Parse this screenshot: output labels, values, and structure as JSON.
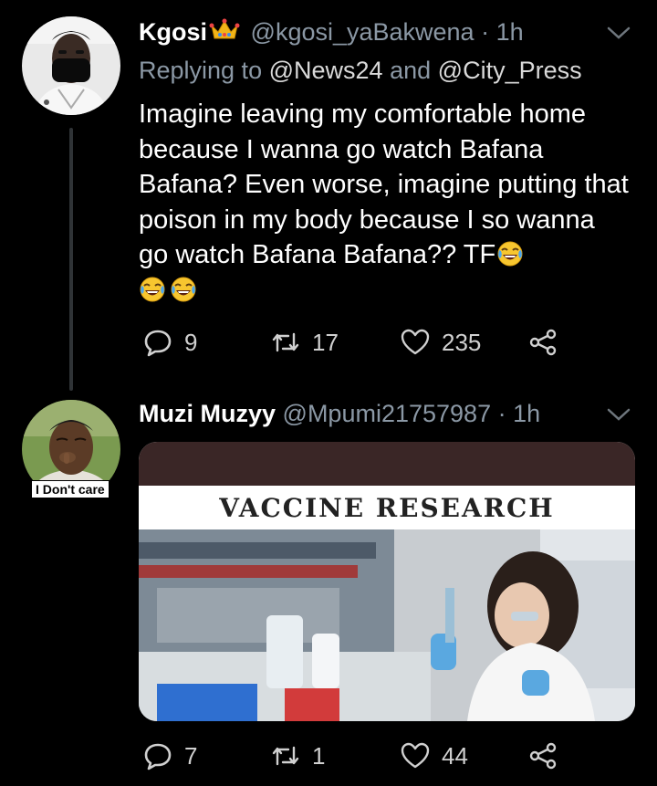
{
  "tweet1": {
    "name": "Kgosi",
    "handle": "@kgosi_yaBakwena",
    "time": "· 1h",
    "replying_prefix": "Replying to",
    "reply_user1": "@News24",
    "reply_and": "and",
    "reply_user2": "@City_Press",
    "body": "Imagine leaving my comfortable home because I wanna go watch Bafana Bafana? Even worse, imagine putting that poison in my body because I so wanna go watch Bafana Bafana?? TF",
    "name_badge": "crown-emoji",
    "body_emojis": [
      "face-with-tears-of-joy",
      "face-with-tears-of-joy",
      "face-with-tears-of-joy"
    ],
    "replies": "9",
    "retweets": "17",
    "likes": "235"
  },
  "tweet2": {
    "name": "Muzi Muzyy",
    "handle": "@Mpumi21757987",
    "time": "· 1h",
    "avatar_caption": "I Don't care",
    "media_title": "VACCINE RESEARCH",
    "replies": "7",
    "retweets": "1",
    "likes": "44"
  },
  "colors": {
    "background": "#000000",
    "secondary_text": "#8b98a5",
    "thread_line": "#2f3336",
    "emoji_yellow": "#f7c62f"
  }
}
